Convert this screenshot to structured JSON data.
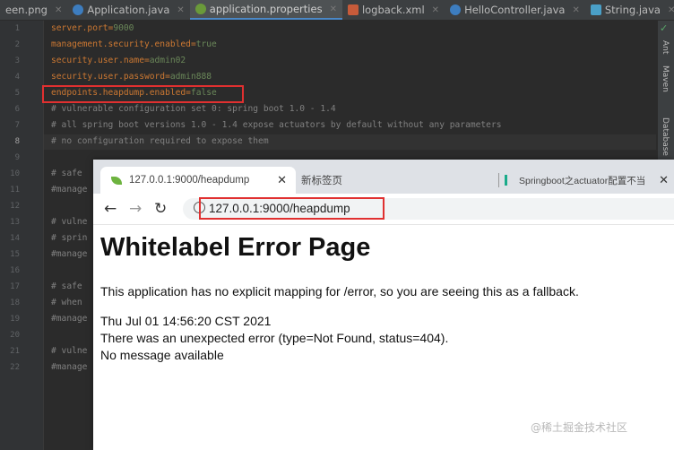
{
  "ide": {
    "tabs": [
      {
        "label": "een.png",
        "icon": "image-file-icon"
      },
      {
        "label": "Application.java",
        "icon": "java-class-icon"
      },
      {
        "label": "application.properties",
        "icon": "properties-file-icon",
        "active": true
      },
      {
        "label": "logback.xml",
        "icon": "xml-file-icon"
      },
      {
        "label": "HelloController.java",
        "icon": "java-class-icon"
      },
      {
        "label": "String.java",
        "icon": "java-class-icon"
      }
    ],
    "more_label": "≡",
    "line_numbers": [
      "1",
      "2",
      "3",
      "4",
      "5",
      "6",
      "7",
      "8",
      "9",
      "10",
      "11",
      "12",
      "13",
      "14",
      "15",
      "16",
      "17",
      "18",
      "19",
      "20",
      "21",
      "22"
    ],
    "code": [
      {
        "key": "server.port=",
        "value": "9000"
      },
      {
        "key": "management.security.enabled=",
        "value": "true"
      },
      {
        "key": "security.user.name=",
        "value": "admin02"
      },
      {
        "key": "security.user.password=",
        "value": "admin888"
      },
      {
        "key": "endpoints.heapdump.enabled=",
        "value": "false"
      },
      {
        "comment": "# vulnerable configuration set 0: spring boot 1.0 - 1.4"
      },
      {
        "comment": "# all spring boot versions 1.0 - 1.4 expose actuators by default without any parameters"
      },
      {
        "comment": "# no configuration required to expose them"
      },
      {
        "comment": ""
      },
      {
        "comment": "# safe"
      },
      {
        "comment": "#manage"
      },
      {
        "comment": ""
      },
      {
        "comment": "# vulne"
      },
      {
        "comment": "# sprin"
      },
      {
        "comment": "#manage"
      },
      {
        "comment": ""
      },
      {
        "comment": "# safe"
      },
      {
        "comment": "# when"
      },
      {
        "comment": "#manage"
      },
      {
        "comment": ""
      },
      {
        "comment": "# vulne"
      },
      {
        "comment": "#manage"
      }
    ],
    "right_tools": [
      "Ant",
      "Maven",
      "Database"
    ],
    "check_mark": "✓",
    "colors": {
      "keyword": "#cc7832",
      "value": "#6a8759",
      "comment": "#808080",
      "highlight": "#e03030"
    }
  },
  "browser": {
    "tabs": [
      {
        "label": "127.0.0.1:9000/heapdump",
        "close": "✕"
      },
      {
        "label": "新标签页",
        "close": "✕"
      },
      {
        "label": "Springboot之actuator配置不当",
        "close": "×"
      }
    ],
    "nav": {
      "back": "←",
      "forward": "→",
      "reload": "↻"
    },
    "url": "127.0.0.1:9000/heapdump",
    "info_icon": "i",
    "page": {
      "title": "Whitelabel Error Page",
      "description": "This application has no explicit mapping for /error, so you are seeing this as a fallback.",
      "timestamp": "Thu Jul 01 14:56:20 CST 2021",
      "error": "There was an unexpected error (type=Not Found, status=404).",
      "message": "No message available"
    }
  },
  "watermark": "@稀土掘金技术社区"
}
